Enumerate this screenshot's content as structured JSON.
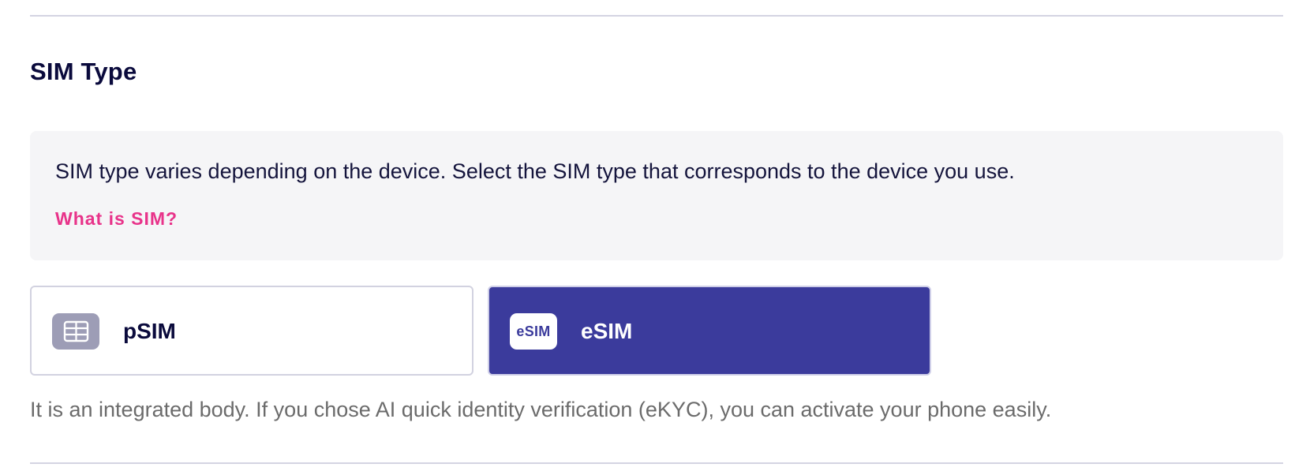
{
  "section": {
    "title": "SIM Type"
  },
  "info": {
    "text": "SIM type varies depending on the device. Select the SIM type that corresponds to the device you use.",
    "link_label": "What is SIM?"
  },
  "options": [
    {
      "label": "pSIM",
      "icon": "physical-sim-card-icon",
      "selected": false
    },
    {
      "label": "eSIM",
      "icon": "esim-icon",
      "icon_text": "eSIM",
      "selected": true
    }
  ],
  "description": "It is an integrated body. If you chose AI quick identity verification (eKYC), you can activate your phone easily.",
  "colors": {
    "selected_bg": "#3b3b9c",
    "link": "#e8338a",
    "heading": "#0a0a3c",
    "info_bg": "#f5f5f7",
    "muted_text": "#6b6b6b",
    "psim_icon_bg": "#9d9db6"
  }
}
